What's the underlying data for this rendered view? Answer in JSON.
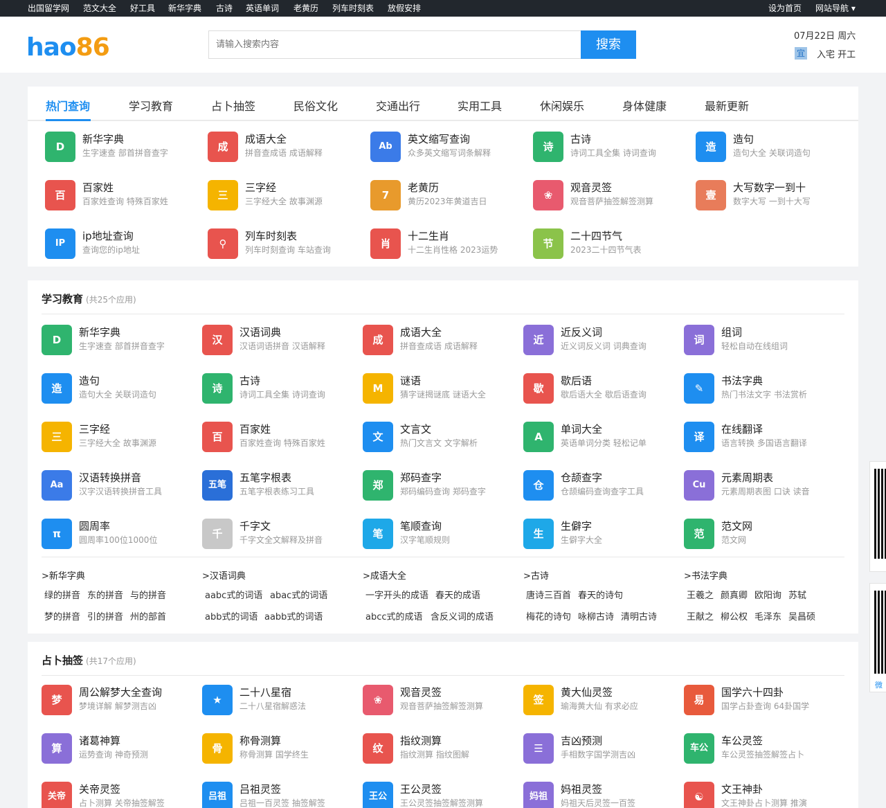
{
  "topbar": [
    "出国留学网",
    "范文大全",
    "好工具",
    "新华字典",
    "古诗",
    "英语单词",
    "老黄历",
    "列车时刻表",
    "放假安排"
  ],
  "topbar_right": {
    "home": "设为首页",
    "nav": "网站导航"
  },
  "logo": {
    "part1": "hao",
    "part2": "86"
  },
  "search": {
    "placeholder": "请输入搜索内容",
    "button": "搜索"
  },
  "date": "07月22日 周六",
  "yi": {
    "badge": "宜",
    "text": "入宅 开工"
  },
  "tabs": [
    "热门查询",
    "学习教育",
    "占卜抽签",
    "民俗文化",
    "交通出行",
    "实用工具",
    "休闲娱乐",
    "身体健康",
    "最新更新"
  ],
  "hot": [
    {
      "t": "新华字典",
      "s": "生字速查 部首拼音查字",
      "g": "D",
      "c": "#2fb46e"
    },
    {
      "t": "成语大全",
      "s": "拼音查成语 成语解释",
      "g": "成",
      "c": "#e8544e"
    },
    {
      "t": "英文缩写查询",
      "s": "众多英文缩写词条解释",
      "g": "Ab",
      "c": "#3b7be8"
    },
    {
      "t": "古诗",
      "s": "诗词工具全集 诗词查询",
      "g": "诗",
      "c": "#2fb46e"
    },
    {
      "t": "造句",
      "s": "造句大全 关联词造句",
      "g": "造",
      "c": "#1e8ef0"
    },
    {
      "t": "百家姓",
      "s": "百家姓查询 特殊百家姓",
      "g": "百",
      "c": "#e8544e"
    },
    {
      "t": "三字经",
      "s": "三字经大全 故事渊源",
      "g": "三",
      "c": "#f5b400"
    },
    {
      "t": "老黄历",
      "s": "黄历2023年黄道吉日",
      "g": "7",
      "c": "#e89a2c"
    },
    {
      "t": "观音灵签",
      "s": "观音菩萨抽签解签测算",
      "g": "❀",
      "c": "#e85a6e"
    },
    {
      "t": "大写数字一到十",
      "s": "数字大写 一到十大写",
      "g": "壹",
      "c": "#e87c5a"
    },
    {
      "t": "ip地址查询",
      "s": "查询您的ip地址",
      "g": "IP",
      "c": "#1e8ef0"
    },
    {
      "t": "列车时刻表",
      "s": "列车时刻查询 车站查询",
      "g": "⚲",
      "c": "#e8544e"
    },
    {
      "t": "十二生肖",
      "s": "十二生肖性格 2023运势",
      "g": "肖",
      "c": "#e8544e"
    },
    {
      "t": "二十四节气",
      "s": "2023二十四节气表",
      "g": "节",
      "c": "#8bc34a"
    }
  ],
  "edu": {
    "title": "学习教育",
    "count": "(共25个应用)",
    "items": [
      {
        "t": "新华字典",
        "s": "生字速查 部首拼音查字",
        "g": "D",
        "c": "#2fb46e"
      },
      {
        "t": "汉语词典",
        "s": "汉语词语拼音 汉语解释",
        "g": "汉",
        "c": "#e8544e"
      },
      {
        "t": "成语大全",
        "s": "拼音查成语 成语解释",
        "g": "成",
        "c": "#e8544e"
      },
      {
        "t": "近反义词",
        "s": "近义词反义词 词典查询",
        "g": "近",
        "c": "#8a6fd8"
      },
      {
        "t": "组词",
        "s": "轻松自动在线组词",
        "g": "词",
        "c": "#8a6fd8"
      },
      {
        "t": "造句",
        "s": "造句大全 关联词造句",
        "g": "造",
        "c": "#1e8ef0"
      },
      {
        "t": "古诗",
        "s": "诗词工具全集 诗词查询",
        "g": "诗",
        "c": "#2fb46e"
      },
      {
        "t": "谜语",
        "s": "猜字谜揭谜底 谜语大全",
        "g": "M",
        "c": "#f5b400"
      },
      {
        "t": "歇后语",
        "s": "歇后语大全 歇后语查询",
        "g": "歇",
        "c": "#e8544e"
      },
      {
        "t": "书法字典",
        "s": "热门书法文字 书法赏析",
        "g": "✎",
        "c": "#1e8ef0"
      },
      {
        "t": "三字经",
        "s": "三字经大全 故事渊源",
        "g": "三",
        "c": "#f5b400"
      },
      {
        "t": "百家姓",
        "s": "百家姓查询 特殊百家姓",
        "g": "百",
        "c": "#e8544e"
      },
      {
        "t": "文言文",
        "s": "热门文言文 文字解析",
        "g": "文",
        "c": "#1e8ef0"
      },
      {
        "t": "单词大全",
        "s": "英语单词分类 轻松记单",
        "g": "A",
        "c": "#2fb46e"
      },
      {
        "t": "在线翻译",
        "s": "语言转换 多国语言翻译",
        "g": "译",
        "c": "#1e8ef0"
      },
      {
        "t": "汉语转换拼音",
        "s": "汉字汉语转换拼音工具",
        "g": "Aa",
        "c": "#3b7be8"
      },
      {
        "t": "五笔字根表",
        "s": "五笔字根表练习工具",
        "g": "五笔",
        "c": "#2a6fd8"
      },
      {
        "t": "郑码查字",
        "s": "郑码编码查询 郑码查字",
        "g": "郑",
        "c": "#2fb46e"
      },
      {
        "t": "仓颉查字",
        "s": "仓颉编码查询查字工具",
        "g": "仓",
        "c": "#1e8ef0"
      },
      {
        "t": "元素周期表",
        "s": "元素周期表图 口诀 读音",
        "g": "Cu",
        "c": "#8a6fd8"
      },
      {
        "t": "圆周率",
        "s": "圆周率100位1000位",
        "g": "π",
        "c": "#1e8ef0"
      },
      {
        "t": "千字文",
        "s": "千字文全文解释及拼音",
        "g": "千",
        "c": "#c8c8c8"
      },
      {
        "t": "笔顺查询",
        "s": "汉字笔顺规则",
        "g": "笔",
        "c": "#1ea8e8"
      },
      {
        "t": "生僻字",
        "s": "生僻字大全",
        "g": "生",
        "c": "#1ea8e8"
      },
      {
        "t": "范文网",
        "s": "范文网",
        "g": "范",
        "c": "#2fb46e"
      }
    ],
    "links": [
      {
        "h": ">新华字典",
        "r1": [
          "绿的拼音",
          "东的拼音",
          "与的拼音"
        ],
        "r2": [
          "梦的拼音",
          "引的拼音",
          "州的部首"
        ]
      },
      {
        "h": ">汉语词典",
        "r1": [
          "aabc式的词语",
          "abac式的词语"
        ],
        "r2": [
          "abb式的词语",
          "aabb式的词语"
        ]
      },
      {
        "h": ">成语大全",
        "r1": [
          "一字开头的成语",
          "春天的成语"
        ],
        "r2": [
          "abcc式的成语",
          "含反义词的成语"
        ]
      },
      {
        "h": ">古诗",
        "r1": [
          "唐诗三百首",
          "春天的诗句"
        ],
        "r2": [
          "梅花的诗句",
          "咏柳古诗",
          "清明古诗"
        ]
      },
      {
        "h": ">书法字典",
        "r1": [
          "王羲之",
          "颜真卿",
          "欧阳询",
          "苏轼"
        ],
        "r2": [
          "王献之",
          "柳公权",
          "毛泽东",
          "吴昌硕"
        ]
      }
    ]
  },
  "div": {
    "title": "占卜抽签",
    "count": "(共17个应用)",
    "items": [
      {
        "t": "周公解梦大全查询",
        "s": "梦境详解 解梦测吉凶",
        "g": "梦",
        "c": "#e8544e"
      },
      {
        "t": "二十八星宿",
        "s": "二十八星宿解惑法",
        "g": "★",
        "c": "#1e8ef0"
      },
      {
        "t": "观音灵签",
        "s": "观音菩萨抽签解签测算",
        "g": "❀",
        "c": "#e85a6e"
      },
      {
        "t": "黄大仙灵签",
        "s": "瑜海黄大仙 有求必应",
        "g": "签",
        "c": "#f5b400"
      },
      {
        "t": "国学六十四卦",
        "s": "国学占卦查询 64卦国学",
        "g": "易",
        "c": "#e85a3c"
      },
      {
        "t": "诸葛神算",
        "s": "运势查询 神奇预测",
        "g": "算",
        "c": "#8a6fd8"
      },
      {
        "t": "称骨测算",
        "s": "称骨测算 国学终生",
        "g": "骨",
        "c": "#f5b400"
      },
      {
        "t": "指纹测算",
        "s": "指纹测算 指纹图解",
        "g": "纹",
        "c": "#e8544e"
      },
      {
        "t": "吉凶预测",
        "s": "手相数字国学测吉凶",
        "g": "☰",
        "c": "#8a6fd8"
      },
      {
        "t": "车公灵签",
        "s": "车公灵签抽签解签占卜",
        "g": "车公",
        "c": "#2fb46e"
      },
      {
        "t": "关帝灵签",
        "s": "占卜测算 关帝抽签解签",
        "g": "关帝",
        "c": "#e8544e"
      },
      {
        "t": "吕祖灵签",
        "s": "吕祖一百灵签 抽签解签",
        "g": "吕祖",
        "c": "#1e8ef0"
      },
      {
        "t": "王公灵签",
        "s": "王公灵签抽签解签测算",
        "g": "王公",
        "c": "#1e8ef0"
      },
      {
        "t": "妈祖灵签",
        "s": "妈祖天后灵签一百签",
        "g": "妈祖",
        "c": "#8a6fd8"
      },
      {
        "t": "文王神卦",
        "s": "文王神卦占卜测算 推演",
        "g": "☯",
        "c": "#e8544e"
      }
    ]
  },
  "qr": {
    "label": "微"
  }
}
